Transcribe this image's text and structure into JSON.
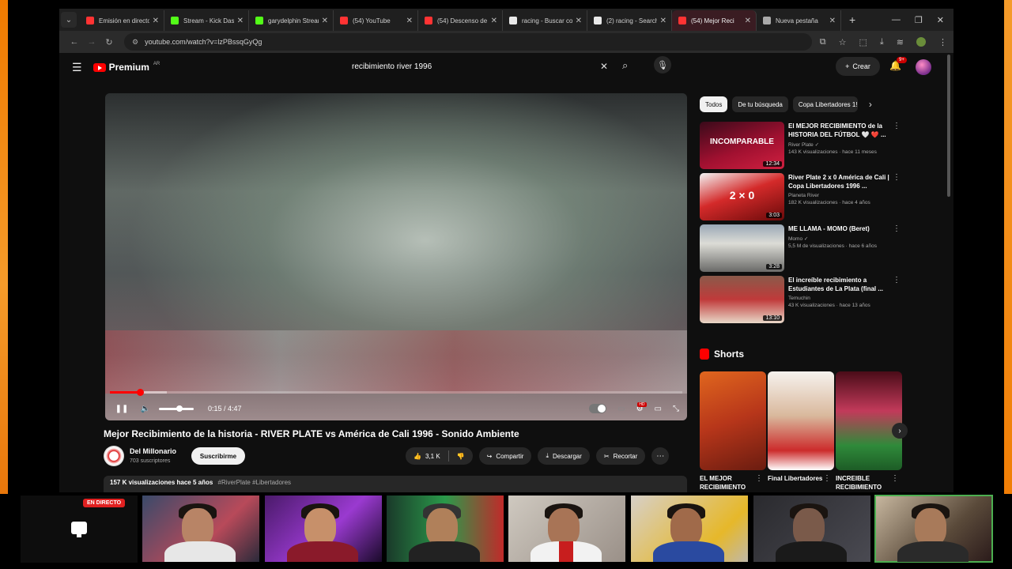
{
  "browser": {
    "tabs": [
      {
        "title": "Emisión en directo",
        "color": "#ff3333"
      },
      {
        "title": "Stream - Kick Dashb",
        "color": "#53fc18"
      },
      {
        "title": "garydelphin Stream",
        "color": "#53fc18"
      },
      {
        "title": "(54) YouTube",
        "color": "#ff3333"
      },
      {
        "title": "(54) Descenso de R",
        "color": "#ff3333"
      },
      {
        "title": "racing - Buscar con",
        "color": "#e8e8e8"
      },
      {
        "title": "(2) racing - Search",
        "color": "#e8e8e8"
      },
      {
        "title": "(54) Mejor Reci",
        "color": "#ff3333"
      },
      {
        "title": "Nueva pestaña",
        "color": "#aaaaaa"
      }
    ],
    "url": "youtube.com/watch?v=lzPBssqGyQg"
  },
  "youtube": {
    "logo_text": "Premium",
    "logo_region": "AR",
    "search_query": "recibimiento river 1996",
    "create_label": "Crear",
    "notif_count": "9+"
  },
  "player": {
    "time": "0:15 / 4:47",
    "progress": 0.053
  },
  "video": {
    "title": "Mejor Recibimiento de la historia - RIVER PLATE vs América de Cali 1996 - Sonido Ambiente",
    "channel": "Del Millonario",
    "subs": "703 suscriptores",
    "subscribe_label": "Suscribirme",
    "likes": "3,1 K",
    "share_label": "Compartir",
    "download_label": "Descargar",
    "clip_label": "Recortar",
    "desc_stats": "157 K visualizaciones  hace 5 años",
    "desc_tags": "#RiverPlate #Libertadores"
  },
  "sidebar": {
    "chips": [
      "Todos",
      "De tu búsqueda",
      "Copa Libertadores 1!"
    ],
    "recs": [
      {
        "title": "El MEJOR RECIBIMIENTO de la HISTORIA DEL FÚTBOL 🤍 ❤️ ...",
        "channel": "River Plate ✓",
        "meta": "143 K visualizaciones · hace 11 meses",
        "duration": "12:34",
        "thumb_text": "INCOMPARABLE"
      },
      {
        "title": "River Plate 2 x 0 América de Cali | Copa Libertadores 1996 ...",
        "channel": "Planeta River",
        "meta": "182 K visualizaciones · hace 4 años",
        "duration": "3:03",
        "thumb_text": "2 × 0"
      },
      {
        "title": "ME LLAMA - MOMO (Beret)",
        "channel": "Momo ✓",
        "meta": "5,5 M de visualizaciones · hace 6 años",
        "duration": "3:28",
        "thumb_text": ""
      },
      {
        "title": "El increíble recibimiento a Estudiantes de La Plata (final ...",
        "channel": "Temuchin",
        "meta": "43 K visualizaciones · hace 13 años",
        "duration": "13:10",
        "thumb_text": ""
      }
    ],
    "shorts_label": "Shorts",
    "shorts": [
      {
        "title": "EL MEJOR RECIBIMIENTO"
      },
      {
        "title": "Final Libertadores"
      },
      {
        "title": "INCREIBLE RECIBIMIENTO"
      }
    ]
  },
  "stream": {
    "live_label": "EN DIRECTO"
  }
}
